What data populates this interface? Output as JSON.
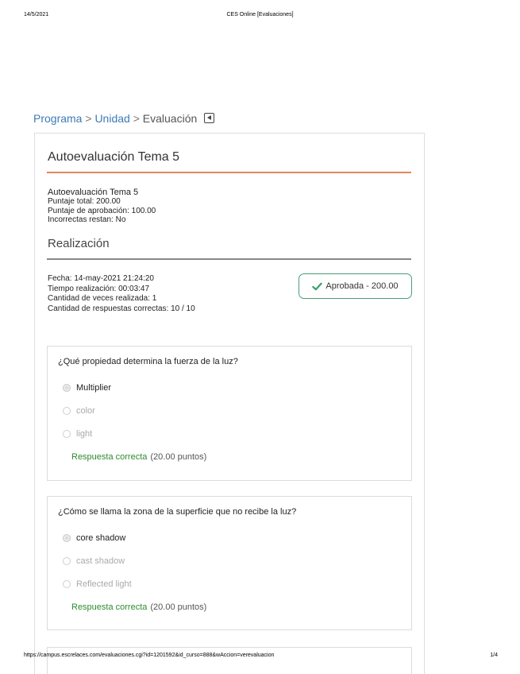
{
  "print_header": {
    "date": "14/5/2021",
    "title": "CES Online [Evaluaciones]"
  },
  "print_footer": {
    "url": "https://campus.escrelaces.com/evaluaciones.cgi?id=1201592&id_curso=888&wAccion=verevaluacion",
    "page": "1/4"
  },
  "breadcrumb": {
    "item1": "Programa",
    "sep1": ">",
    "item2": "Unidad",
    "sep2": ">",
    "current": "Evaluación"
  },
  "card": {
    "title": "Autoevaluación Tema 5",
    "info": {
      "name": "Autoevaluación Tema 5",
      "total": "Puntaje total: 200.00",
      "pass": "Puntaje de aprobación: 100.00",
      "wrong": "Incorrectas restan: No"
    },
    "section_title": "Realización",
    "realizacion": {
      "fecha": "Fecha: 14-may-2021 21:24:20",
      "tiempo": "Tiempo realización: 00:03:47",
      "veces": "Cantidad de veces realizada: 1",
      "correctas": "Cantidad de respuestas correctas: 10 / 10"
    },
    "badge": {
      "label": "Aprobada - 200.00",
      "icon": "check-icon",
      "color": "#4a9d7a"
    }
  },
  "questions": [
    {
      "text": "¿Qué propiedad determina la fuerza de la luz?",
      "options": [
        "Multiplier",
        "color",
        "light"
      ],
      "selected": 0,
      "result": "Respuesta correcta",
      "points": "(20.00 puntos)"
    },
    {
      "text": "¿Cómo se llama la zona de la superficie que no recibe la luz?",
      "options": [
        "core shadow",
        "cast shadow",
        "Reflected light"
      ],
      "selected": 0,
      "result": "Respuesta correcta",
      "points": "(20.00 puntos)"
    }
  ],
  "colors": {
    "link": "#3d7ab8",
    "accent": "#e8845a",
    "correct": "#2e8b2e"
  }
}
